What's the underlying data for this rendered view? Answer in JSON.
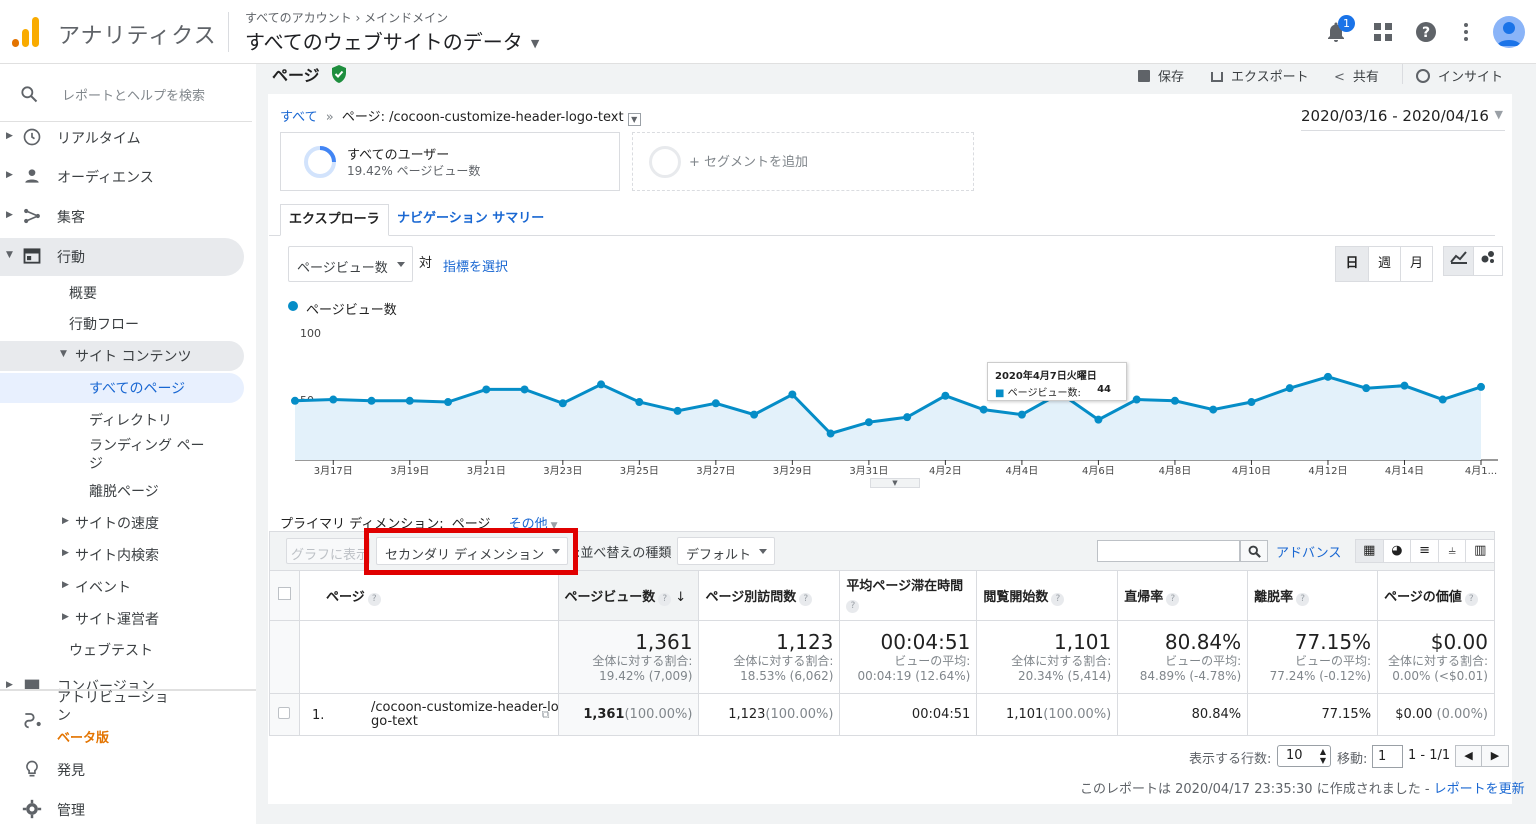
{
  "header": {
    "app_title": "アナリティクス",
    "breadcrumb": "すべてのアカウント › メインドメイン",
    "property": "すべてのウェブサイトのデータ",
    "notification_count": "1"
  },
  "sidebar": {
    "search_placeholder": "レポートとヘルプを検索",
    "items": [
      {
        "label": "リアルタイム"
      },
      {
        "label": "オーディエンス"
      },
      {
        "label": "集客"
      },
      {
        "label": "行動"
      },
      {
        "label": "概要"
      },
      {
        "label": "行動フロー"
      },
      {
        "label": "サイト コンテンツ"
      },
      {
        "label": "すべてのページ"
      },
      {
        "label": "ディレクトリ"
      },
      {
        "label": "ランディング ページ"
      },
      {
        "label": "離脱ページ"
      },
      {
        "label": "サイトの速度"
      },
      {
        "label": "サイト内検索"
      },
      {
        "label": "イベント"
      },
      {
        "label": "サイト運営者"
      },
      {
        "label": "ウェブテスト"
      },
      {
        "label": "コンバージョン"
      }
    ],
    "attribution": "アトリビューション",
    "beta": "ベータ版",
    "discover": "発見",
    "admin": "管理"
  },
  "report": {
    "title": "ページ",
    "save": "保存",
    "export": "エクスポート",
    "share": "共有",
    "insights": "インサイト",
    "crumb_all": "すべて",
    "crumb_page": "ページ: /cocoon-customize-header-logo-text",
    "date_range": "2020/03/16 - 2020/04/16",
    "segment_name": "すべてのユーザー",
    "segment_stat": "19.42% ページビュー数",
    "add_segment": "+ セグメントを追加",
    "tab_explorer": "エクスプローラ",
    "tab_nav": "ナビゲーション サマリー",
    "metric_dd": "ページビュー数",
    "vs": "対",
    "select_metric": "指標を選択",
    "day": "日",
    "week": "週",
    "month": "月",
    "legend": "ページビュー数",
    "tooltip_date": "2020年4月7日火曜日",
    "tooltip_label": "ページビュー数:",
    "tooltip_value": "44"
  },
  "chart_data": {
    "type": "line",
    "series": [
      {
        "name": "ページビュー数",
        "values": [
          47,
          48,
          47,
          47,
          46,
          56,
          56,
          45,
          60,
          46,
          39,
          45,
          36,
          52,
          21,
          30,
          34,
          51,
          40,
          36,
          53,
          32,
          48,
          47,
          40,
          46,
          57,
          66,
          57,
          59,
          48,
          58
        ]
      }
    ],
    "ylim": [
      0,
      100
    ],
    "yticks": [
      "100",
      "50"
    ],
    "xticks": [
      "3月17日",
      "3月19日",
      "3月21日",
      "3月23日",
      "3月25日",
      "3月27日",
      "3月29日",
      "3月31日",
      "4月2日",
      "4月4日",
      "4月6日",
      "4月8日",
      "4月10日",
      "4月12日",
      "4月14日",
      "4月1..."
    ]
  },
  "controls": {
    "primary_dim_label": "プライマリ ディメンション:",
    "primary_dim_value": "ページ",
    "other": "その他",
    "plot_rows": "グラフに表示",
    "secondary_dim": "セカンダリ ディメンション",
    "sort_label": "並べ替えの種類:",
    "sort_value": "デフォルト",
    "advanced": "アドバンス"
  },
  "table": {
    "headers": [
      "ページ",
      "ページビュー数",
      "ページ別訪問数",
      "平均ページ滞在時間",
      "閲覧開始数",
      "直帰率",
      "離脱率",
      "ページの価値"
    ],
    "totals": [
      {
        "big": "1,361",
        "l1": "全体に対する割合:",
        "l2": "19.42% (7,009)"
      },
      {
        "big": "1,123",
        "l1": "全体に対する割合:",
        "l2": "18.53% (6,062)"
      },
      {
        "big": "00:04:51",
        "l1": "ビューの平均:",
        "l2": "00:04:19 (12.64%)"
      },
      {
        "big": "1,101",
        "l1": "全体に対する割合:",
        "l2": "20.34% (5,414)"
      },
      {
        "big": "80.84%",
        "l1": "ビューの平均:",
        "l2": "84.89% (-4.78%)"
      },
      {
        "big": "77.15%",
        "l1": "ビューの平均:",
        "l2": "77.24% (-0.12%)"
      },
      {
        "big": "$0.00",
        "l1": "全体に対する割合:",
        "l2": "0.00% (<$0.01)"
      }
    ],
    "row": {
      "num": "1.",
      "page": "/cocoon-customize-header-logo-text",
      "pv": "1,361",
      "pv_pct": "(100.00%)",
      "upv": "1,123",
      "upv_pct": "(100.00%)",
      "time": "00:04:51",
      "ent": "1,101",
      "ent_pct": "(100.00%)",
      "bounce": "80.84%",
      "exit": "77.15%",
      "value": "$0.00",
      "value_pct": "(0.00%)"
    }
  },
  "pager": {
    "rows_label": "表示する行数:",
    "rows_value": "10",
    "goto_label": "移動:",
    "goto_value": "1",
    "range": "1 - 1/1",
    "created": "このレポートは 2020/04/17 23:35:30 に作成されました - ",
    "refresh": "レポートを更新"
  }
}
